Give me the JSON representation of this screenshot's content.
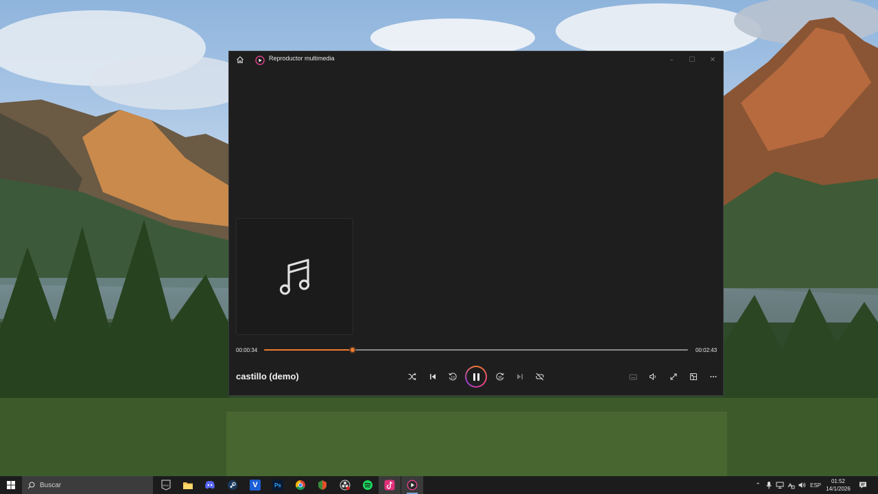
{
  "window": {
    "title": "Reproductor multimedia",
    "controls": {
      "minimize": "–",
      "maximize": "☐",
      "close": "✕"
    }
  },
  "player": {
    "current_time": "00:00:34",
    "total_time": "00:02:43",
    "progress": 0.2086,
    "track_title": "castillo (demo)",
    "is_playing": true,
    "accent_color": "#f07a2f",
    "controls": [
      "shuffle-icon",
      "previous-icon",
      "rewind-10-icon",
      "pause-icon",
      "forward-30-icon",
      "next-icon",
      "repeat-off-icon"
    ],
    "right_controls": [
      "mini-player-icon",
      "volume-icon",
      "fullscreen-icon",
      "cast-icon",
      "more-icon"
    ]
  },
  "taskbar": {
    "search_placeholder": "Buscar",
    "epic_label": "EPIC",
    "vscode_label": "V",
    "ps_label": "Ps",
    "apps": [
      "epic-games-icon",
      "file-explorer-icon",
      "discord-icon",
      "steam-icon",
      "v-app-icon",
      "photoshop-icon",
      "chrome-icon",
      "app-icon",
      "obs-icon",
      "spotify-icon",
      "tiktok-icon",
      "media-player-icon"
    ],
    "language": "ESP",
    "time": "01:52",
    "date": "14/1/2026"
  }
}
